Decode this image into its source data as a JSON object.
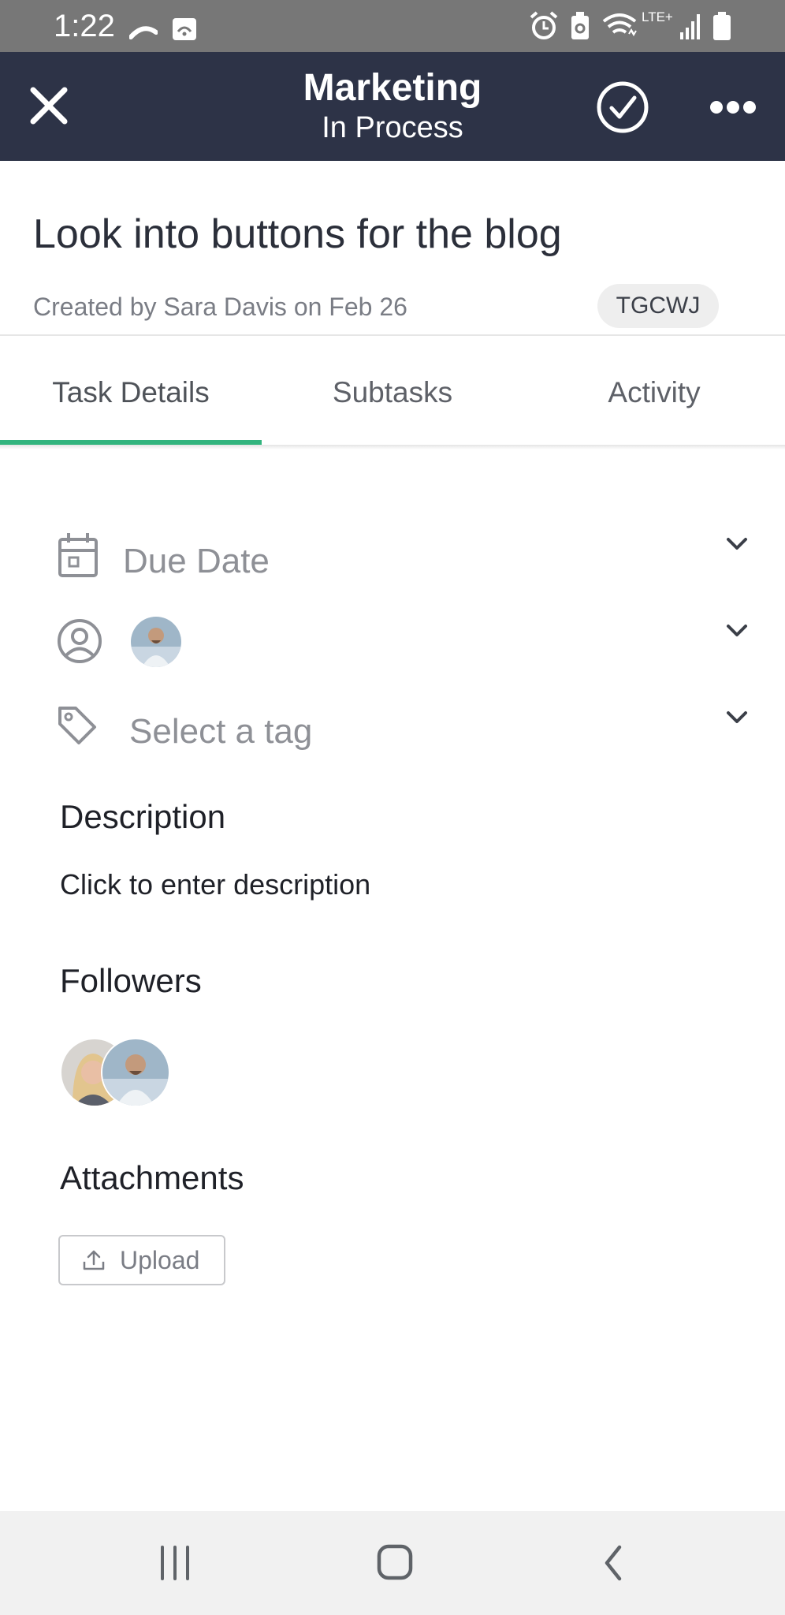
{
  "status_bar": {
    "time": "1:22",
    "network_label": "LTE+",
    "icons": [
      "cast-icon",
      "image-icon",
      "alarm-icon",
      "battery-saver-icon",
      "wifi-icon",
      "signal-icon",
      "battery-icon"
    ]
  },
  "header": {
    "title": "Marketing",
    "subtitle": "In Process",
    "close_icon": "close-icon",
    "complete_icon": "check-circle-icon",
    "more_icon": "more-icon",
    "background_color": "#2d3347"
  },
  "task": {
    "title": "Look into buttons for the blog",
    "created_by": "Created by Sara Davis  on Feb 26",
    "id": "TGCWJ"
  },
  "tabs": [
    {
      "label": "Task Details",
      "active": true
    },
    {
      "label": "Subtasks",
      "active": false
    },
    {
      "label": "Activity",
      "active": false
    }
  ],
  "accent_color": "#32b47e",
  "fields": {
    "due_date": {
      "label": "Due Date",
      "icon": "calendar-icon"
    },
    "assignee": {
      "icon": "user-icon"
    },
    "tag": {
      "label": "Select a tag",
      "icon": "tag-icon"
    }
  },
  "description": {
    "heading": "Description",
    "placeholder": "Click to enter description"
  },
  "followers": {
    "heading": "Followers"
  },
  "attachments": {
    "heading": "Attachments",
    "upload_label": "Upload"
  },
  "nav": {
    "icons": [
      "recents-icon",
      "home-icon",
      "back-icon"
    ]
  }
}
